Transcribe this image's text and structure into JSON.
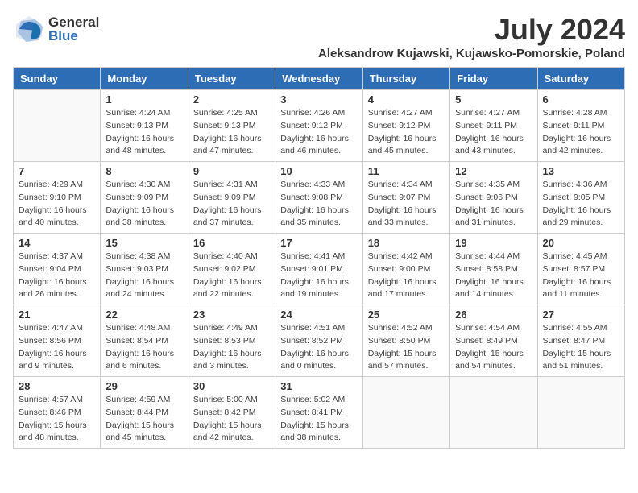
{
  "header": {
    "logo_general": "General",
    "logo_blue": "Blue",
    "month_year": "July 2024",
    "location": "Aleksandrow Kujawski, Kujawsko-Pomorskie, Poland"
  },
  "weekdays": [
    "Sunday",
    "Monday",
    "Tuesday",
    "Wednesday",
    "Thursday",
    "Friday",
    "Saturday"
  ],
  "weeks": [
    [
      {
        "day": "",
        "info": ""
      },
      {
        "day": "1",
        "info": "Sunrise: 4:24 AM\nSunset: 9:13 PM\nDaylight: 16 hours\nand 48 minutes."
      },
      {
        "day": "2",
        "info": "Sunrise: 4:25 AM\nSunset: 9:13 PM\nDaylight: 16 hours\nand 47 minutes."
      },
      {
        "day": "3",
        "info": "Sunrise: 4:26 AM\nSunset: 9:12 PM\nDaylight: 16 hours\nand 46 minutes."
      },
      {
        "day": "4",
        "info": "Sunrise: 4:27 AM\nSunset: 9:12 PM\nDaylight: 16 hours\nand 45 minutes."
      },
      {
        "day": "5",
        "info": "Sunrise: 4:27 AM\nSunset: 9:11 PM\nDaylight: 16 hours\nand 43 minutes."
      },
      {
        "day": "6",
        "info": "Sunrise: 4:28 AM\nSunset: 9:11 PM\nDaylight: 16 hours\nand 42 minutes."
      }
    ],
    [
      {
        "day": "7",
        "info": "Sunrise: 4:29 AM\nSunset: 9:10 PM\nDaylight: 16 hours\nand 40 minutes."
      },
      {
        "day": "8",
        "info": "Sunrise: 4:30 AM\nSunset: 9:09 PM\nDaylight: 16 hours\nand 38 minutes."
      },
      {
        "day": "9",
        "info": "Sunrise: 4:31 AM\nSunset: 9:09 PM\nDaylight: 16 hours\nand 37 minutes."
      },
      {
        "day": "10",
        "info": "Sunrise: 4:33 AM\nSunset: 9:08 PM\nDaylight: 16 hours\nand 35 minutes."
      },
      {
        "day": "11",
        "info": "Sunrise: 4:34 AM\nSunset: 9:07 PM\nDaylight: 16 hours\nand 33 minutes."
      },
      {
        "day": "12",
        "info": "Sunrise: 4:35 AM\nSunset: 9:06 PM\nDaylight: 16 hours\nand 31 minutes."
      },
      {
        "day": "13",
        "info": "Sunrise: 4:36 AM\nSunset: 9:05 PM\nDaylight: 16 hours\nand 29 minutes."
      }
    ],
    [
      {
        "day": "14",
        "info": "Sunrise: 4:37 AM\nSunset: 9:04 PM\nDaylight: 16 hours\nand 26 minutes."
      },
      {
        "day": "15",
        "info": "Sunrise: 4:38 AM\nSunset: 9:03 PM\nDaylight: 16 hours\nand 24 minutes."
      },
      {
        "day": "16",
        "info": "Sunrise: 4:40 AM\nSunset: 9:02 PM\nDaylight: 16 hours\nand 22 minutes."
      },
      {
        "day": "17",
        "info": "Sunrise: 4:41 AM\nSunset: 9:01 PM\nDaylight: 16 hours\nand 19 minutes."
      },
      {
        "day": "18",
        "info": "Sunrise: 4:42 AM\nSunset: 9:00 PM\nDaylight: 16 hours\nand 17 minutes."
      },
      {
        "day": "19",
        "info": "Sunrise: 4:44 AM\nSunset: 8:58 PM\nDaylight: 16 hours\nand 14 minutes."
      },
      {
        "day": "20",
        "info": "Sunrise: 4:45 AM\nSunset: 8:57 PM\nDaylight: 16 hours\nand 11 minutes."
      }
    ],
    [
      {
        "day": "21",
        "info": "Sunrise: 4:47 AM\nSunset: 8:56 PM\nDaylight: 16 hours\nand 9 minutes."
      },
      {
        "day": "22",
        "info": "Sunrise: 4:48 AM\nSunset: 8:54 PM\nDaylight: 16 hours\nand 6 minutes."
      },
      {
        "day": "23",
        "info": "Sunrise: 4:49 AM\nSunset: 8:53 PM\nDaylight: 16 hours\nand 3 minutes."
      },
      {
        "day": "24",
        "info": "Sunrise: 4:51 AM\nSunset: 8:52 PM\nDaylight: 16 hours\nand 0 minutes."
      },
      {
        "day": "25",
        "info": "Sunrise: 4:52 AM\nSunset: 8:50 PM\nDaylight: 15 hours\nand 57 minutes."
      },
      {
        "day": "26",
        "info": "Sunrise: 4:54 AM\nSunset: 8:49 PM\nDaylight: 15 hours\nand 54 minutes."
      },
      {
        "day": "27",
        "info": "Sunrise: 4:55 AM\nSunset: 8:47 PM\nDaylight: 15 hours\nand 51 minutes."
      }
    ],
    [
      {
        "day": "28",
        "info": "Sunrise: 4:57 AM\nSunset: 8:46 PM\nDaylight: 15 hours\nand 48 minutes."
      },
      {
        "day": "29",
        "info": "Sunrise: 4:59 AM\nSunset: 8:44 PM\nDaylight: 15 hours\nand 45 minutes."
      },
      {
        "day": "30",
        "info": "Sunrise: 5:00 AM\nSunset: 8:42 PM\nDaylight: 15 hours\nand 42 minutes."
      },
      {
        "day": "31",
        "info": "Sunrise: 5:02 AM\nSunset: 8:41 PM\nDaylight: 15 hours\nand 38 minutes."
      },
      {
        "day": "",
        "info": ""
      },
      {
        "day": "",
        "info": ""
      },
      {
        "day": "",
        "info": ""
      }
    ]
  ]
}
